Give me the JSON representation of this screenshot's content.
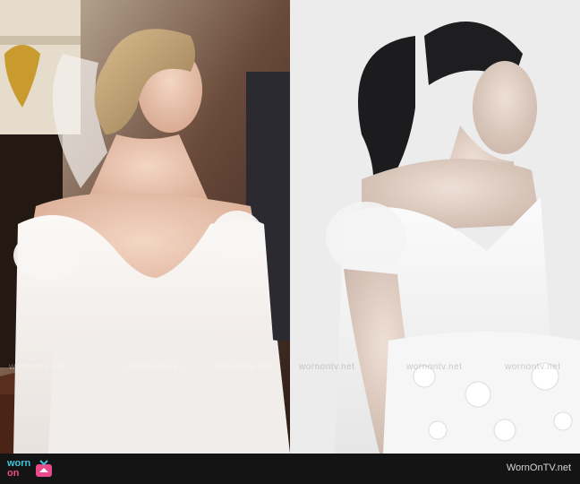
{
  "image": {
    "left_photo_alt": "Bride in off-the-shoulder white tulle gown seated in a church",
    "right_photo_alt": "Model wearing the same off-the-shoulder white tulle gown with floral appliques"
  },
  "watermark": {
    "text": "wornontv.net"
  },
  "footer": {
    "logo_line1": "worn",
    "logo_line2": "on",
    "credit": "WornOnTV.net"
  },
  "colors": {
    "footer_bg": "#141414",
    "logo_cyan": "#3fc4d9",
    "logo_pink": "#e94a8a"
  }
}
